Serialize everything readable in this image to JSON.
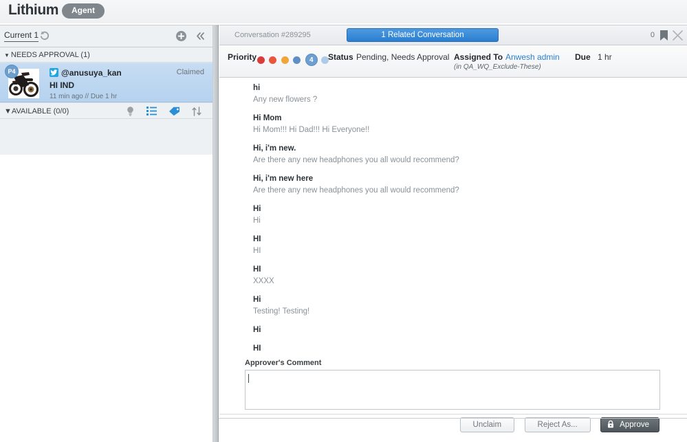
{
  "brand": {
    "logo": "Lithium",
    "mode_pill": "Agent"
  },
  "sidebar": {
    "tab_current": "Current 1",
    "icons": {
      "history": "history-icon",
      "add": "add-circle-icon",
      "collapse": "chevron-double-left-icon"
    },
    "groups": [
      {
        "label": "NEEDS APPROVAL (1)"
      }
    ],
    "conversation": {
      "priority_badge": "P4",
      "network": "twitter-icon",
      "username": "@anusuya_kan",
      "claim_status": "Claimed",
      "subject": "HI IND",
      "meta": "11 min ago //  Due 1 hr"
    },
    "available": {
      "label": "AVAILABLE (0/0)",
      "icons": [
        "lightbulb-icon",
        "list-icon",
        "tag-icon",
        "sort-icon"
      ]
    }
  },
  "conversation_header": {
    "id_label": "Conversation #289295",
    "related_button": "1 Related Conversation",
    "note_count": "0",
    "flag_icon": "bookmark-icon",
    "close_icon": "close-icon"
  },
  "meta": {
    "priority_label": "Priority",
    "priority_value": "4",
    "priority_dots": [
      "#d93d3a",
      "#e8573c",
      "#f0a63a",
      "#5f8fc4",
      "#6d9fd0",
      "#aecbe8"
    ],
    "status_label": "Status",
    "status_value": "Pending, Needs Approval",
    "assigned_label": "Assigned To",
    "assigned_value": "Anwesh admin",
    "assigned_sub": "(in QA_WQ_Exclude-These)",
    "due_label": "Due",
    "due_value": "1 hr"
  },
  "messages": [
    {
      "title": "hi",
      "body": "Any new flowers ?"
    },
    {
      "title": "Hi Mom",
      "body": "Hi Mom!!!   Hi Dad!!!   Hi Everyone!!"
    },
    {
      "title": "Hi, i'm new.",
      "body": "Are there any new headphones you all would recommend?"
    },
    {
      "title": "Hi, i'm new here",
      "body": "Are there any new headphones you all would recommend?"
    },
    {
      "title": "Hi",
      "body": "Hi"
    },
    {
      "title": "HI",
      "body": "HI"
    },
    {
      "title": "HI",
      "body": "XXXX"
    },
    {
      "title": "Hi",
      "body": "Testing! Testing!"
    },
    {
      "title": "Hi",
      "body": ""
    },
    {
      "title": "HI",
      "body": ""
    }
  ],
  "approver": {
    "label": "Approver's Comment",
    "value": "",
    "placeholder": ""
  },
  "actions": {
    "unclaim": "Unclaim",
    "reject": "Reject As...",
    "approve": "Approve",
    "approve_icon": "lock-icon"
  },
  "colors": {
    "accent_blue": "#2a7fd1",
    "selected_row": "#b5d2ef",
    "dark_button": "#5b6267"
  }
}
